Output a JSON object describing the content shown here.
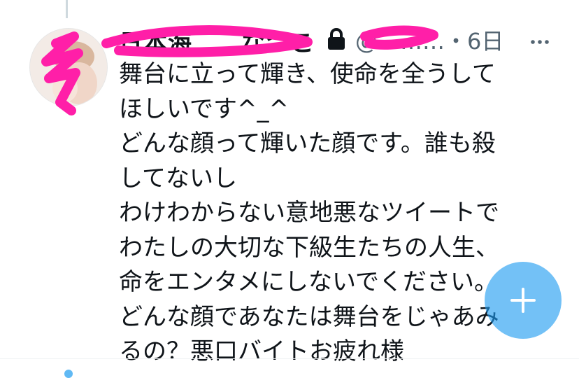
{
  "tweet": {
    "author_name": "日本海　　なつこ",
    "handle": "@………",
    "time": "・6日",
    "lines": [
      "舞台に立って輝き、使命を全うして",
      "ほしいです^_^",
      "どんな顔って輝いた顔です。誰も殺",
      "してないし",
      "わけわからない意地悪なツイートで",
      "わたしの大切な下級生たちの人生、",
      "命をエンタメにしないでください。",
      "どんな顔であなたは舞台をじゃあみ",
      "るの？悪口バイトお疲れ様"
    ]
  },
  "icons": {
    "lock": "lock-icon",
    "more": "more-horizontal-icon",
    "compose": "plus-icon"
  },
  "colors": {
    "text": "#0f1419",
    "secondary": "#536471",
    "accent": "#1d9bf0",
    "redaction": "#ff1fa8"
  }
}
